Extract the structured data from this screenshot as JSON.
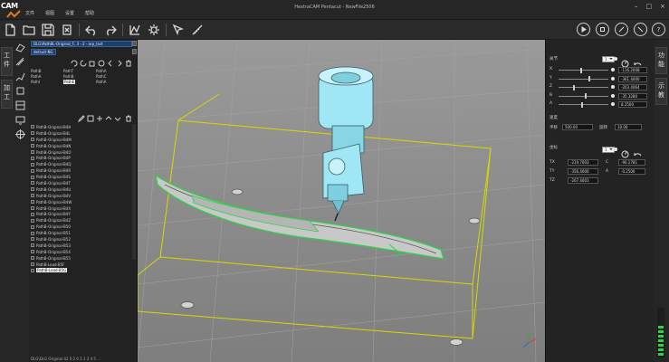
{
  "app": {
    "logo_text": "CAM",
    "title": "HextraCAM Pentacut - NewFile2506",
    "window_buttons": [
      "–",
      "□",
      "×"
    ]
  },
  "menu": [
    "文件",
    "视图",
    "设置",
    "帮助"
  ],
  "toolbar": {
    "left_tools": [
      "new-file-icon",
      "open-folder-icon",
      "save-icon",
      "close-file-icon",
      "undo-icon",
      "redo-icon",
      "toolpath-icon",
      "settings-gear-icon",
      "select-tool-icon",
      "measure-tool-icon"
    ],
    "right_tools": [
      "play-icon",
      "stop-icon",
      "step-icon",
      "reset-icon",
      "help-icon"
    ],
    "help_label": "?"
  },
  "left_tabs": [
    {
      "label": "工件"
    },
    {
      "label": "加工"
    }
  ],
  "left_panel": {
    "combo1": "DLG\\PathBL-Original_F, 3 - 2 - arp_last",
    "combo2": "default-NG",
    "tool_grid": [
      "PathB",
      "PathT",
      "PathA",
      "PathA",
      "PathB",
      "PathC",
      "PathI",
      "PathE",
      "PathA"
    ],
    "path_items": [
      "PathB-Original-B4H",
      "PathB-Original-B4L",
      "PathB-Original-B4M",
      "PathB-Original-B4N",
      "PathB-Original-B4O",
      "PathB-Original-B4P",
      "PathB-Original-B4Q",
      "PathB-Original-B4R",
      "PathB-Original-B4S",
      "PathB-Original-B4T",
      "PathB-Original-B4U",
      "PathB-Original-B4V",
      "PathB-Original-B4W",
      "PathB-Original-B4X",
      "PathB-Original-B4Y",
      "PathB-Original-B4Z",
      "PathB-Original-B50",
      "PathB-Original-B51",
      "PathB-Original-B52",
      "PathB-Original-B53",
      "PathB-Original-B54",
      "PathB-Original-B55",
      "PathB-Lead-B5F",
      "PathB-Lead-B5G"
    ],
    "selected_index": 23,
    "status": "DLG\\DLG Original 42 0 2 0 1 2 3 4 5 ..."
  },
  "right_tabs": [
    {
      "label": "功能"
    },
    {
      "label": "示教"
    }
  ],
  "right_panel": {
    "joint_header": "关节",
    "joint_select": "1",
    "joints": [
      {
        "label": "X",
        "value": "-116.2008",
        "slider": 0.45
      },
      {
        "label": "Y",
        "value": "-361.4000",
        "slider": 0.62
      },
      {
        "label": "Z",
        "value": "-203.4064",
        "slider": 0.3
      },
      {
        "label": "B",
        "value": "-35.3280",
        "slider": 0.55
      },
      {
        "label": "A",
        "value": "8.2500",
        "slider": 0.48
      }
    ],
    "speed_label": "速度",
    "speed_title": "平移",
    "speed_value": "500.00",
    "rotate_title": "旋转",
    "rotate_value": "10.00",
    "coord_header": "坐标",
    "coord_select": "1",
    "coords": [
      {
        "label": "TX",
        "value": "-219.7003"
      },
      {
        "label": "C",
        "value": "-90.1781"
      },
      {
        "label": "TY",
        "value": "-356.4000"
      },
      {
        "label": "A",
        "value": "-0.2500"
      },
      {
        "label": "TZ",
        "value": "-207.4003"
      }
    ]
  },
  "colors": {
    "selection": "#1c3f6e",
    "bbox_yellow": "#d8d800",
    "part_green": "#2fd14a",
    "spindle_cyan": "#9fe7f4"
  }
}
